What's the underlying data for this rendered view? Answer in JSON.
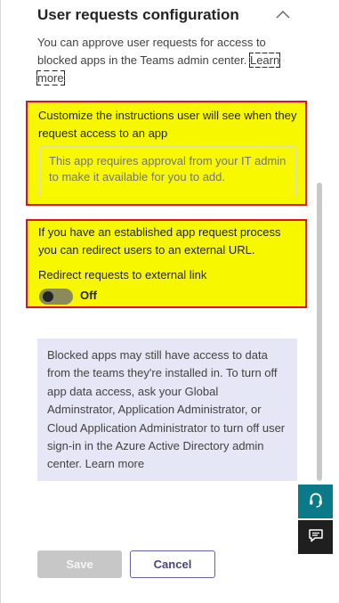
{
  "section": {
    "title": "User requests configuration",
    "description_text": "You can approve user requests for access to blocked apps in the Teams admin center. ",
    "learn_more_label": "Learn more"
  },
  "instructions_box": {
    "label": "Customize the instructions user will see when they request access to an app",
    "placeholder": "This app requires approval from your IT admin to make it available for you to add."
  },
  "redirect_box": {
    "description": "If you have an established app request process you can redirect users to an external URL.",
    "toggle_label": "Redirect requests to external link",
    "toggle_state": "Off",
    "toggle_on": false
  },
  "info_box": {
    "text": "Blocked apps may still have access to data from the teams they're installed in. To turn off app data access, ask your Global Adminstrator, Application Administrator, or Cloud Application Administrator to turn off user sign-in in the Azure Active Directory admin center. ",
    "learn_more_label": "Learn more"
  },
  "side_buttons": {
    "help_icon": "headset-icon",
    "feedback_icon": "feedback-icon"
  },
  "footer": {
    "save_label": "Save",
    "cancel_label": "Cancel"
  },
  "colors": {
    "highlight_fill": "#f7f700",
    "highlight_border": "#e0101c",
    "info_background": "#e6e7f6",
    "accent": "#6264a7",
    "help_button": "#0a7a88"
  }
}
